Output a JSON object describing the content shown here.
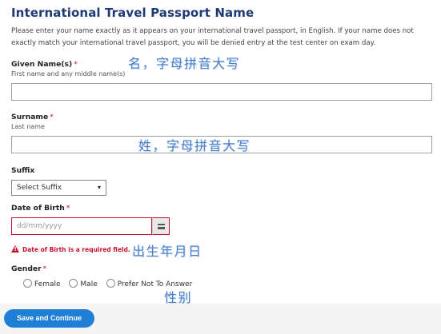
{
  "page": {
    "title": "International Travel Passport Name",
    "intro": "Please enter your name exactly as it appears on your international travel passport, in English. If your name does not exactly match your international travel passport, you will be denied entry at the test center on exam day."
  },
  "given_name": {
    "label": "Given Name(s)",
    "required_mark": "*",
    "hint": "First name and any middle name(s)",
    "value": "",
    "annotation": "名，字母拼音大写"
  },
  "surname": {
    "label": "Surname",
    "required_mark": "*",
    "hint": "Last name",
    "value": "",
    "annotation": "姓，字母拼音大写"
  },
  "suffix": {
    "label": "Suffix",
    "selected": "Select Suffix"
  },
  "dob": {
    "label": "Date of Birth",
    "required_mark": "*",
    "placeholder": "dd/mm/yyyy",
    "error": "Date of Birth is a required field.",
    "annotation": "出生年月日"
  },
  "gender": {
    "label": "Gender",
    "required_mark": "*",
    "options": [
      "Female",
      "Male",
      "Prefer Not To Answer"
    ],
    "annotation": "性别"
  },
  "footer": {
    "save_label": "Save and Continue"
  },
  "colors": {
    "title": "#1f3b73",
    "required": "#c8102e",
    "button": "#1f7fd6",
    "annotation": "#4a7fc8"
  }
}
